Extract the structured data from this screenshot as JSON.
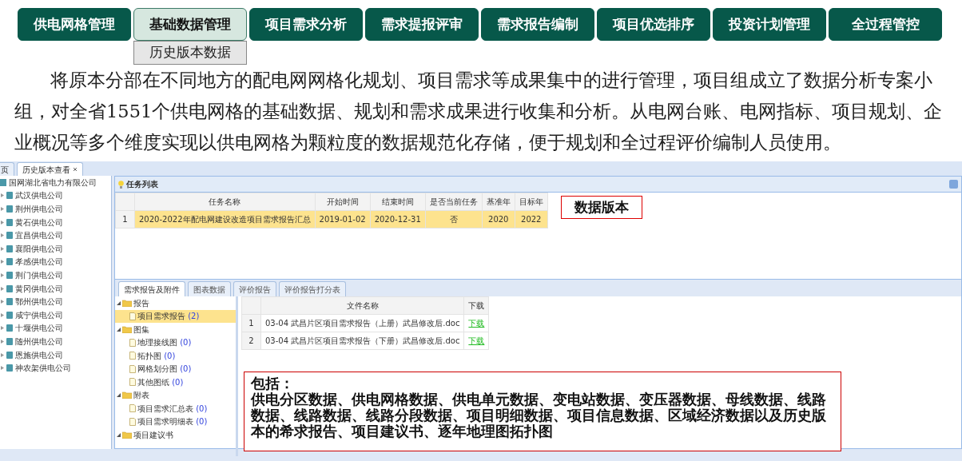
{
  "nav": [
    {
      "label": "供电网格管理",
      "selected": false
    },
    {
      "label": "基础数据管理",
      "selected": true,
      "submenu": [
        "历史版本数据"
      ]
    },
    {
      "label": "项目需求分析",
      "selected": false
    },
    {
      "label": "需求提报评审",
      "selected": false
    },
    {
      "label": "需求报告编制",
      "selected": false
    },
    {
      "label": "项目优选排序",
      "selected": false
    },
    {
      "label": "投资计划管理",
      "selected": false
    },
    {
      "label": "全过程管控",
      "selected": false
    }
  ],
  "paragraph": "将原本分部在不同地方的配电网网格化规划、项目需求等成果集中的进行管理，项目组成立了数据分析专案小组，对全省1551个供电网格的基础数据、规划和需求成果进行收集和分析。从电网台账、电网指标、项目规划、企业概况等多个维度实现以供电网格为颗粒度的数据规范化存储，便于规划和全过程评价编制人员使用。",
  "app": {
    "tabs": [
      {
        "label": "页",
        "selected": false,
        "closable": false
      },
      {
        "label": "历史版本查看",
        "selected": true,
        "closable": true
      }
    ],
    "org_tree": {
      "label": "国网湖北省电力有限公司",
      "children": [
        {
          "label": "武汉供电公司"
        },
        {
          "label": "荆州供电公司"
        },
        {
          "label": "黄石供电公司"
        },
        {
          "label": "宜昌供电公司"
        },
        {
          "label": "襄阳供电公司"
        },
        {
          "label": "孝感供电公司"
        },
        {
          "label": "荆门供电公司"
        },
        {
          "label": "黄冈供电公司"
        },
        {
          "label": "鄂州供电公司"
        },
        {
          "label": "咸宁供电公司"
        },
        {
          "label": "十堰供电公司"
        },
        {
          "label": "随州供电公司"
        },
        {
          "label": "恩施供电公司"
        },
        {
          "label": "神农架供电公司"
        }
      ]
    },
    "task_panel": {
      "title": "任务列表",
      "columns": [
        "任务名称",
        "开始时间",
        "结束时间",
        "是否当前任务",
        "基准年",
        "目标年"
      ],
      "rows": [
        {
          "index": "1",
          "cells": [
            "2020-2022年配电网建设改造项目需求报告汇总",
            "2019-01-02",
            "2020-12-31",
            "否",
            "2020",
            "2022"
          ],
          "selected": true
        }
      ]
    },
    "callout_version": "数据版本",
    "sub_tabs": [
      {
        "label": "需求报告及附件",
        "selected": true
      },
      {
        "label": "图表数据",
        "selected": false
      },
      {
        "label": "评价报告",
        "selected": false
      },
      {
        "label": "评价报告打分表",
        "selected": false
      }
    ],
    "file_tree": [
      {
        "label": "报告",
        "expanded": true,
        "children": [
          {
            "label": "项目需求报告",
            "count": "(2)",
            "selected": true
          }
        ]
      },
      {
        "label": "图集",
        "expanded": true,
        "children": [
          {
            "label": "地理接线图",
            "count": "(0)",
            "selected": false
          },
          {
            "label": "拓扑图",
            "count": "(0)",
            "selected": false
          },
          {
            "label": "网格划分图",
            "count": "(0)",
            "selected": false
          },
          {
            "label": "其他图纸",
            "count": "(0)",
            "selected": false
          }
        ]
      },
      {
        "label": "附表",
        "expanded": true,
        "children": [
          {
            "label": "项目需求汇总表",
            "count": "(0)",
            "selected": false
          },
          {
            "label": "项目需求明细表",
            "count": "(0)",
            "selected": false
          }
        ]
      },
      {
        "label": "项目建议书",
        "expanded": true
      }
    ],
    "file_table": {
      "columns": [
        "文件名称",
        "下载"
      ],
      "rows": [
        {
          "index": "1",
          "name": "03-04 武昌片区项目需求报告（上册）武昌修改后.doc",
          "action": "下载"
        },
        {
          "index": "2",
          "name": "03-04 武昌片区项目需求报告（下册）武昌修改后.doc",
          "action": "下载"
        }
      ]
    },
    "callout_includes": {
      "title": "包括：",
      "text": "供电分区数据、供电网格数据、供电单元数据、变电站数据、变压器数据、母线数据、线路数据、线路数据、线路分段数据、项目明细数据、项目信息数据、区域经济数据以及历史版本的希求报告、项目建议书、逐年地理图拓扑图"
    }
  }
}
